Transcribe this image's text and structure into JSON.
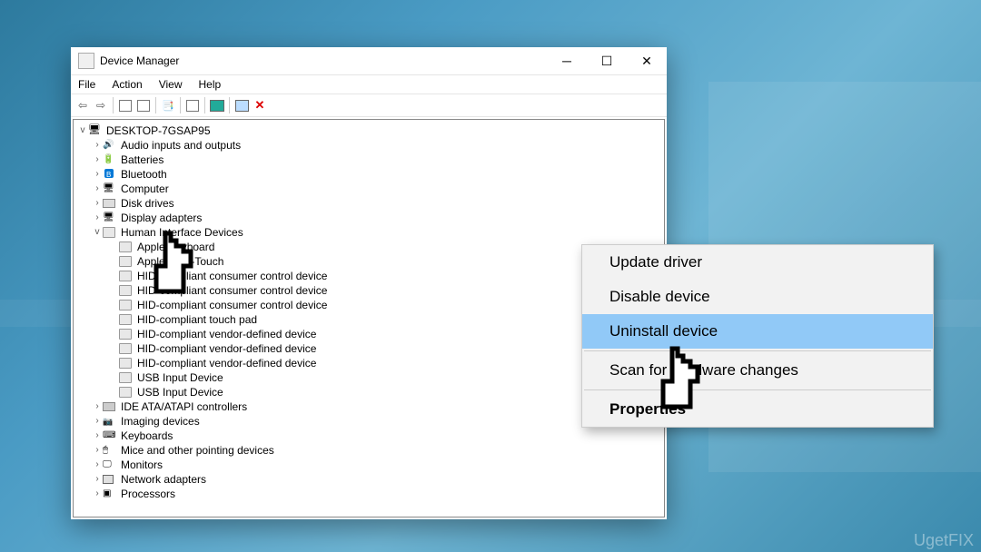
{
  "window": {
    "title": "Device Manager",
    "menus": [
      "File",
      "Action",
      "View",
      "Help"
    ]
  },
  "tree": {
    "root": "DESKTOP-7GSAP95",
    "items": [
      {
        "label": "Audio inputs and outputs",
        "icon": "ic-audio",
        "expand": ">"
      },
      {
        "label": "Batteries",
        "icon": "ic-battery",
        "expand": ">"
      },
      {
        "label": "Bluetooth",
        "icon": "ic-bt",
        "expand": ">"
      },
      {
        "label": "Computer",
        "icon": "ic-comp",
        "expand": ">"
      },
      {
        "label": "Disk drives",
        "icon": "ic-disk",
        "expand": ">"
      },
      {
        "label": "Display adapters",
        "icon": "ic-display",
        "expand": ">"
      },
      {
        "label": "Human Interface Devices",
        "icon": "ic-hid",
        "expand": "v"
      },
      {
        "label": "IDE ATA/ATAPI controllers",
        "icon": "ic-ide",
        "expand": ">"
      },
      {
        "label": "Imaging devices",
        "icon": "ic-img",
        "expand": ">"
      },
      {
        "label": "Keyboards",
        "icon": "ic-kb",
        "expand": ">"
      },
      {
        "label": "Mice and other pointing devices",
        "icon": "ic-mouse",
        "expand": ">"
      },
      {
        "label": "Monitors",
        "icon": "ic-monitor",
        "expand": ">"
      },
      {
        "label": "Network adapters",
        "icon": "ic-net",
        "expand": ">"
      },
      {
        "label": "Processors",
        "icon": "ic-proc",
        "expand": ">"
      }
    ],
    "hid_children": [
      "Apple Keyboard",
      "Apple Multi-Touch",
      "HID-compliant consumer control device",
      "HID-compliant consumer control device",
      "HID-compliant consumer control device",
      "HID-compliant touch pad",
      "HID-compliant vendor-defined device",
      "HID-compliant vendor-defined device",
      "HID-compliant vendor-defined device",
      "USB Input Device",
      "USB Input Device"
    ]
  },
  "context_menu": {
    "items": [
      {
        "label": "Update driver",
        "sel": false
      },
      {
        "label": "Disable device",
        "sel": false
      },
      {
        "label": "Uninstall device",
        "sel": true
      },
      {
        "label": "Scan for hardware changes",
        "sel": false
      },
      {
        "label": "Properties",
        "sel": false,
        "bold": true
      }
    ]
  },
  "watermark": "UgetFIX"
}
